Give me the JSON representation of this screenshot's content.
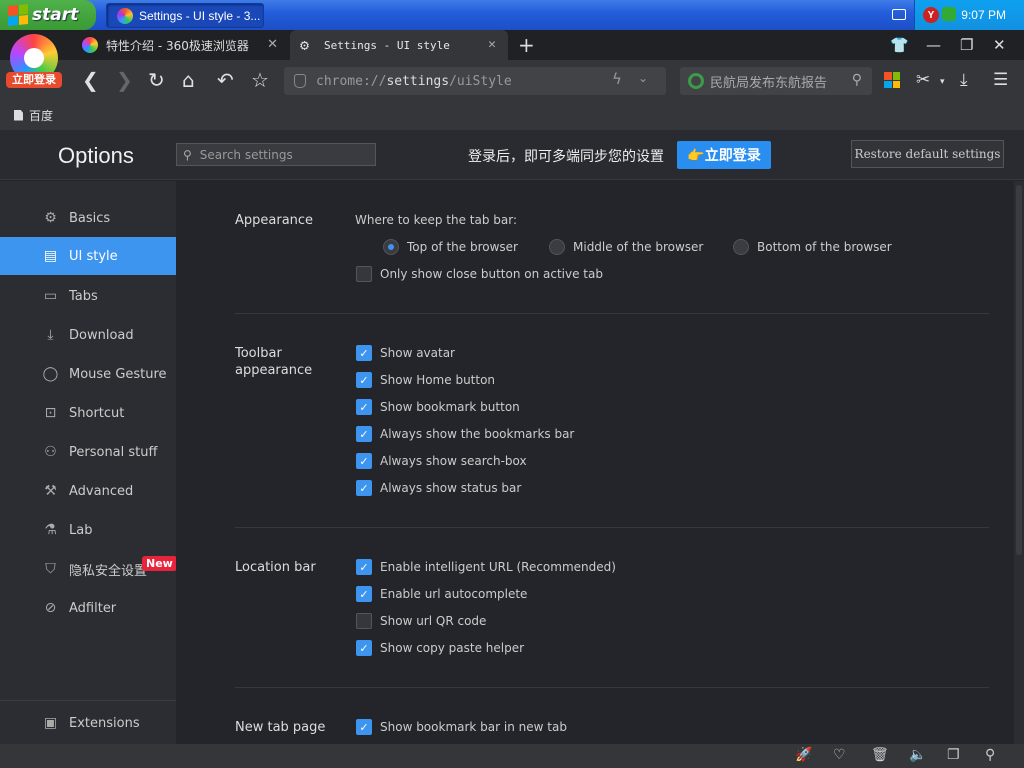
{
  "taskbar": {
    "start_label": "start",
    "task_label": "Settings - UI style - 3...",
    "clock": "9:07 PM",
    "tray_badge": "Y"
  },
  "browser": {
    "avatar_badge": "立即登录",
    "tabs": [
      {
        "label": "特性介绍 - 360极速浏览器",
        "close": "✕"
      },
      {
        "label": "Settings - UI style",
        "close": "✕"
      }
    ],
    "newtab": "+",
    "url": {
      "scheme": "chrome://",
      "host": "settings",
      "path": "/uiStyle"
    },
    "search_box": "民航局发布东航报告",
    "bookmarks": [
      {
        "label": "百度"
      }
    ],
    "colors": {
      "accent": "#3d95f0",
      "login_button": "#2a8ef0",
      "new_badge": "#e8243c",
      "avatar_badge": "#e84a2d",
      "xp_start": "#4fb14a"
    }
  },
  "header": {
    "title": "Options",
    "search_placeholder": "Search settings",
    "sync_text": "登录后，即可多端同步您的设置",
    "login_button": "👉立即登录",
    "restore_button": "Restore default settings"
  },
  "sidebar": {
    "items": [
      {
        "label": "Basics",
        "icon": "gear-icon"
      },
      {
        "label": "UI style",
        "icon": "window-icon",
        "active": true
      },
      {
        "label": "Tabs",
        "icon": "tab-icon"
      },
      {
        "label": "Download",
        "icon": "download-icon"
      },
      {
        "label": "Mouse Gesture",
        "icon": "mouse-icon"
      },
      {
        "label": "Shortcut",
        "icon": "shortcut-icon"
      },
      {
        "label": "Personal stuff",
        "icon": "person-icon"
      },
      {
        "label": "Advanced",
        "icon": "wrench-icon"
      },
      {
        "label": "Lab",
        "icon": "flask-icon"
      },
      {
        "label": "隐私安全设置",
        "icon": "shield-icon",
        "badge": "New"
      },
      {
        "label": "Adfilter",
        "icon": "block-icon"
      }
    ],
    "extensions": {
      "label": "Extensions",
      "icon": "extensions-icon"
    }
  },
  "sections": {
    "appearance": {
      "title": "Appearance",
      "tabbar_question": "Where to keep the tab bar:",
      "radios": [
        {
          "label": "Top of the browser",
          "checked": true
        },
        {
          "label": "Middle of the browser",
          "checked": false
        },
        {
          "label": "Bottom of the browser",
          "checked": false
        }
      ],
      "close_button_option": {
        "label": "Only show close button on active tab",
        "checked": false
      }
    },
    "toolbar": {
      "title": "Toolbar\nappearance",
      "options": [
        {
          "label": "Show avatar",
          "checked": true
        },
        {
          "label": "Show Home button",
          "checked": true
        },
        {
          "label": "Show bookmark button",
          "checked": true
        },
        {
          "label": "Always show the bookmarks bar",
          "checked": true
        },
        {
          "label": "Always show search-box",
          "checked": true
        },
        {
          "label": "Always show status bar",
          "checked": true
        }
      ]
    },
    "location": {
      "title": "Location bar",
      "options": [
        {
          "label": "Enable intelligent URL (Recommended)",
          "checked": true
        },
        {
          "label": "Enable url autocomplete",
          "checked": true
        },
        {
          "label": "Show url QR code",
          "checked": false
        },
        {
          "label": "Show copy paste helper",
          "checked": true
        }
      ]
    },
    "newtab": {
      "title": "New tab page",
      "options": [
        {
          "label": "Show bookmark bar in new tab",
          "checked": true
        }
      ]
    }
  }
}
